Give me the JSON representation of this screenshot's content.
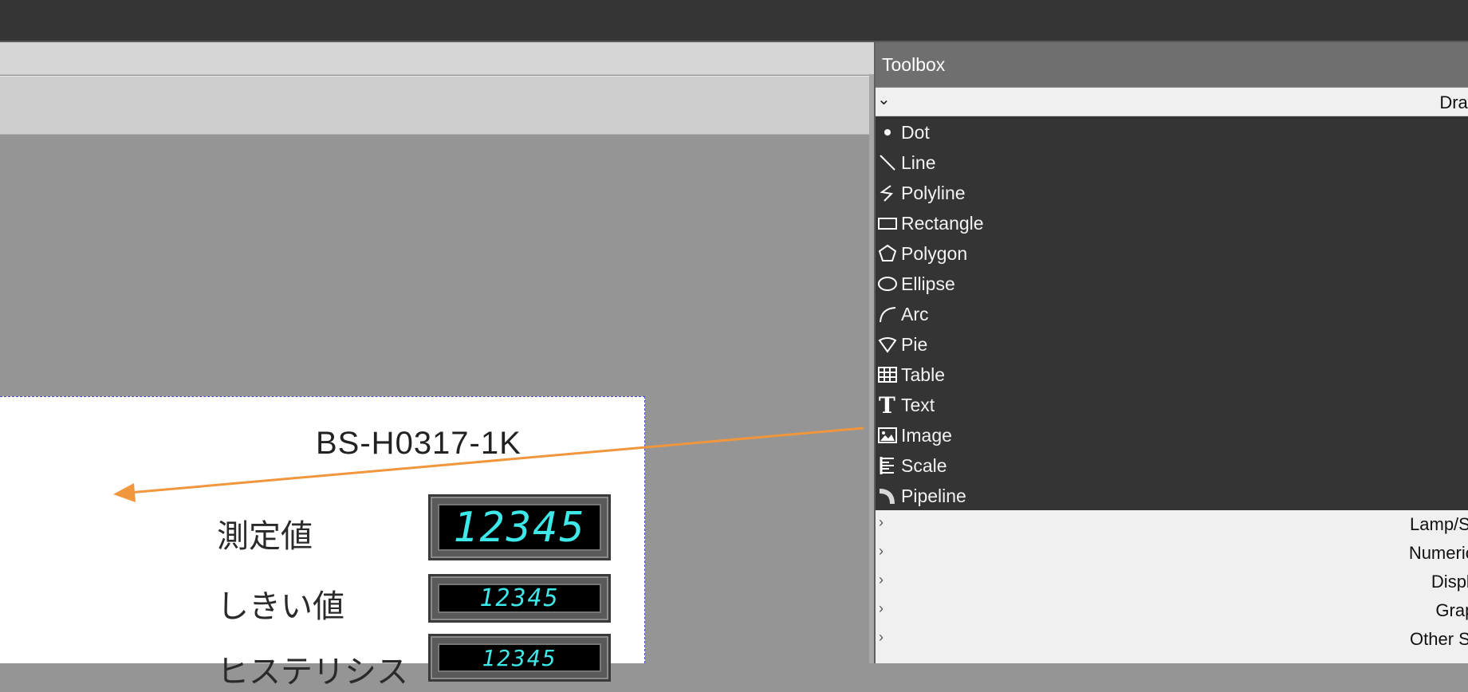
{
  "toolbox": {
    "title": "Toolbox",
    "draw_section": "Draw",
    "tools": [
      {
        "label": "Dot",
        "icon": "dot-icon"
      },
      {
        "label": "Line",
        "icon": "line-icon"
      },
      {
        "label": "Polyline",
        "icon": "polyline-icon"
      },
      {
        "label": "Rectangle",
        "icon": "rectangle-icon"
      },
      {
        "label": "Polygon",
        "icon": "polygon-icon"
      },
      {
        "label": "Ellipse",
        "icon": "ellipse-icon"
      },
      {
        "label": "Arc",
        "icon": "arc-icon"
      },
      {
        "label": "Pie",
        "icon": "pie-icon"
      },
      {
        "label": "Table",
        "icon": "table-icon"
      },
      {
        "label": "Text",
        "icon": "text-icon"
      },
      {
        "label": "Image",
        "icon": "image-icon"
      },
      {
        "label": "Scale",
        "icon": "scale-icon"
      },
      {
        "label": "Pipeline",
        "icon": "pipeline-icon"
      }
    ],
    "categories": [
      "Lamp/Switch",
      "Numeric/Text",
      "Display",
      "Graph",
      "Other Switch"
    ]
  },
  "canvas": {
    "title": "BS-H0317-1K",
    "label_measured": "測定値",
    "label_threshold": "しきい値",
    "label_hysteresis": "ヒステリシス",
    "display_measured": "12345",
    "display_threshold": "12345",
    "display_hysteresis": "12345"
  },
  "colors": {
    "accent_arrow": "#f0963c",
    "segment_digits": "#3ee8e8"
  }
}
